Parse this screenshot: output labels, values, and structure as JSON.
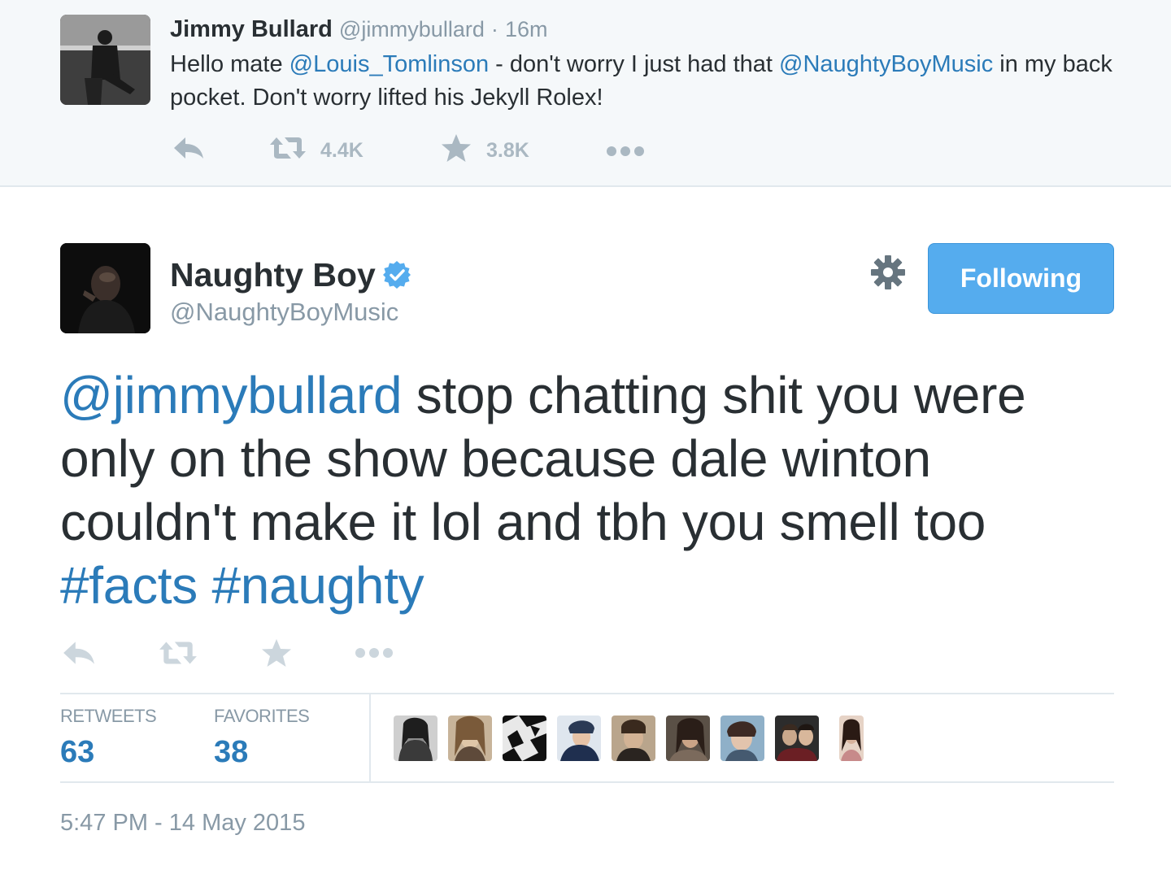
{
  "top_tweet": {
    "author_name": "Jimmy Bullard",
    "handle": "@jimmybullard",
    "dot": "·",
    "time": "16m",
    "text_part1": "Hello mate ",
    "mention1": "@Louis_Tomlinson",
    "text_part2": " - don't worry I just had that ",
    "mention2": "@NaughtyBoyMusic",
    "text_part3": " in my back pocket. Don't worry lifted his Jekyll Rolex!",
    "retweet_count": "4.4K",
    "favorite_count": "3.8K",
    "icons": [
      "reply-icon",
      "retweet-icon",
      "favorite-star-icon",
      "more-dots-icon"
    ]
  },
  "main_tweet": {
    "author_name": "Naughty Boy",
    "handle": "@NaughtyBoyMusic",
    "follow_label": "Following",
    "mention": "@jimmybullard",
    "text": " stop chatting shit you were only on the show because dale winton couldn't make it lol and tbh you smell too ",
    "hashtag1": "#facts",
    "hashtag2": "#naughty",
    "icons": [
      "verified-badge-icon",
      "gear-icon",
      "reply-icon",
      "retweet-icon",
      "favorite-star-icon",
      "more-dots-icon"
    ]
  },
  "stats": {
    "retweets_label": "RETWEETS",
    "retweets_value": "63",
    "favorites_label": "FAVORITES",
    "favorites_value": "38"
  },
  "timestamp": "5:47 PM - 14 May 2015",
  "colors": {
    "link": "#2b7bb9",
    "muted": "#8899a6",
    "follow_button": "#55acee",
    "verified": "#55acee",
    "top_background": "#f5f8fa"
  }
}
